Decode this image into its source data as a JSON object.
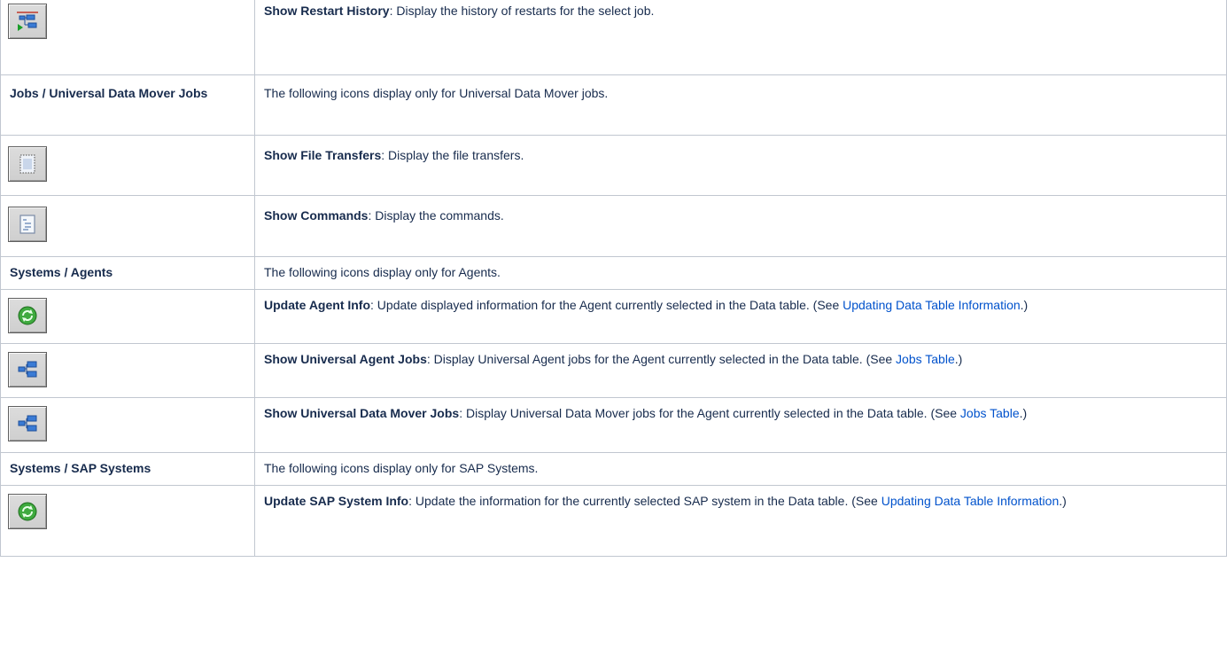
{
  "rows": [
    {
      "icon": "restart-history-icon",
      "title": "Show Restart History",
      "desc": ": Display the history of restarts for the select job."
    },
    {
      "section": "Jobs / Universal Data Mover Jobs",
      "desc": "The following icons display only for Universal Data Mover jobs."
    },
    {
      "icon": "file-transfers-icon",
      "title": "Show File Transfers",
      "desc": ": Display the file transfers."
    },
    {
      "icon": "commands-icon",
      "title": "Show Commands",
      "desc": ": Display the commands."
    },
    {
      "section": "Systems / Agents",
      "desc": "The following icons display only for Agents."
    },
    {
      "icon": "refresh-icon",
      "title": "Update Agent Info",
      "desc": ": Update displayed information for the Agent currently selected in the Data table. (See ",
      "link": "Updating Data Table Information",
      "tail": ".)"
    },
    {
      "icon": "jobs-tree-icon",
      "title": "Show Universal Agent Jobs",
      "desc": ": Display Universal Agent jobs for the Agent currently selected in the Data table. (See ",
      "link": "Jobs Table",
      "tail": ".)"
    },
    {
      "icon": "jobs-tree-icon",
      "title": "Show Universal Data Mover Jobs",
      "desc": ": Display Universal Data Mover jobs for the Agent currently selected in the Data table. (See ",
      "link": "Jobs Table",
      "tail": ".)"
    },
    {
      "section": "Systems / SAP Systems",
      "desc": "The following icons display only for SAP Systems."
    },
    {
      "icon": "refresh-icon",
      "title": "Update SAP System Info",
      "desc": ": Update the information for the currently selected SAP system in the Data table. (See ",
      "link": "Updating Data Table Information",
      "tail": ".)"
    }
  ]
}
